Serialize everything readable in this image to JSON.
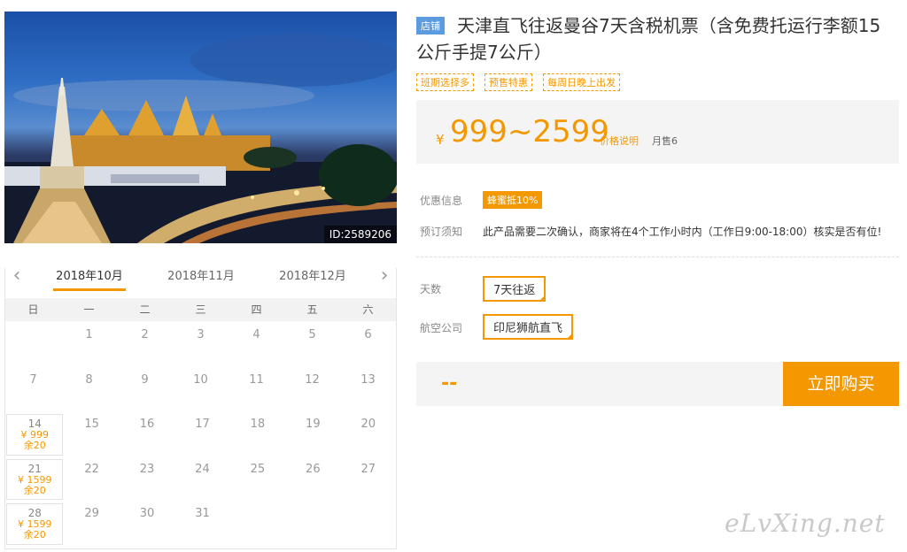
{
  "hero": {
    "image_id": "ID:2589206"
  },
  "calendar": {
    "tabs": [
      "2018年10月",
      "2018年11月",
      "2018年12月"
    ],
    "weekdays": [
      "日",
      "一",
      "二",
      "三",
      "四",
      "五",
      "六"
    ],
    "rows": [
      [
        {
          "d": ""
        },
        {
          "d": "1"
        },
        {
          "d": "2"
        },
        {
          "d": "3"
        },
        {
          "d": "4"
        },
        {
          "d": "5"
        },
        {
          "d": "6"
        }
      ],
      [
        {
          "d": "7"
        },
        {
          "d": "8"
        },
        {
          "d": "9"
        },
        {
          "d": "10"
        },
        {
          "d": "11"
        },
        {
          "d": "12"
        },
        {
          "d": "13"
        }
      ],
      [
        {
          "d": "14",
          "price": "¥ 999",
          "stock": "余20"
        },
        {
          "d": "15"
        },
        {
          "d": "16"
        },
        {
          "d": "17"
        },
        {
          "d": "18"
        },
        {
          "d": "19"
        },
        {
          "d": "20"
        }
      ],
      [
        {
          "d": "21",
          "price": "¥ 1599",
          "stock": "余20"
        },
        {
          "d": "22"
        },
        {
          "d": "23"
        },
        {
          "d": "24"
        },
        {
          "d": "25"
        },
        {
          "d": "26"
        },
        {
          "d": "27"
        }
      ],
      [
        {
          "d": "28",
          "price": "¥ 1599",
          "stock": "余20"
        },
        {
          "d": "29"
        },
        {
          "d": "30"
        },
        {
          "d": "31"
        },
        {
          "d": ""
        },
        {
          "d": ""
        },
        {
          "d": ""
        }
      ]
    ]
  },
  "product": {
    "shop_tag": "店铺",
    "title": "天津直飞往返曼谷7天含税机票（含免费托运行李额15公斤手提7公斤）",
    "badges": [
      "班期选择多",
      "预售特惠",
      "每周日晚上出发"
    ],
    "currency": "¥",
    "price": "999~2599",
    "price_note": "价格说明",
    "sold": "月售6"
  },
  "info": {
    "promo_label": "优惠信息",
    "promo_value": "蜂蜜抵10%",
    "notice_label": "预订须知",
    "notice_value": "此产品需要二次确认，商家将在4个工作小时内（工作日9:00-18:00）核实是否有位!"
  },
  "options": {
    "days_label": "天数",
    "days_value": "7天往返",
    "airline_label": "航空公司",
    "airline_value": "印尼狮航直飞"
  },
  "buy": {
    "total": "--",
    "button": "立即购买"
  },
  "watermark": "eLvXing.net"
}
